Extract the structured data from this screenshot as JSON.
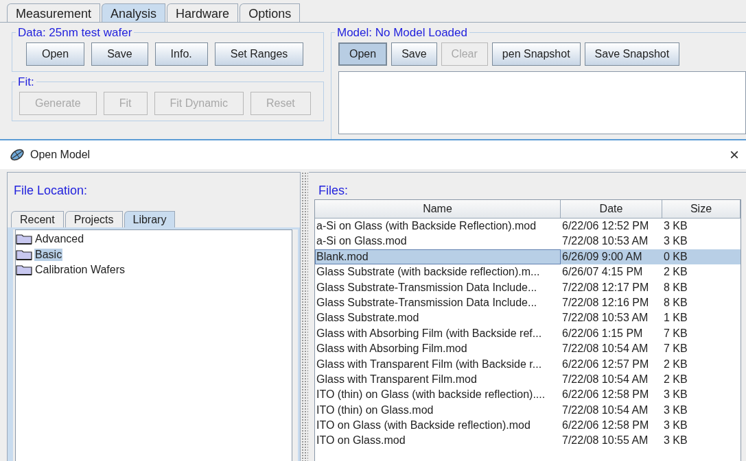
{
  "main_tabs": [
    {
      "label": "Measurement",
      "selected": false
    },
    {
      "label": "Analysis",
      "selected": true
    },
    {
      "label": "Hardware",
      "selected": false
    },
    {
      "label": "Options",
      "selected": false
    }
  ],
  "data_group": {
    "title": "Data: 25nm test wafer",
    "buttons": [
      {
        "label": "Open",
        "disabled": false,
        "pressed": false
      },
      {
        "label": "Save",
        "disabled": false,
        "pressed": false
      },
      {
        "label": "Info.",
        "disabled": false,
        "pressed": false
      },
      {
        "label": "Set Ranges",
        "disabled": false,
        "pressed": false
      }
    ]
  },
  "fit_group": {
    "title": "Fit:",
    "buttons": [
      {
        "label": "Generate",
        "disabled": true,
        "pressed": false
      },
      {
        "label": "Fit",
        "disabled": true,
        "pressed": false
      },
      {
        "label": "Fit Dynamic",
        "disabled": true,
        "pressed": false
      },
      {
        "label": "Reset",
        "disabled": true,
        "pressed": false
      }
    ]
  },
  "model_group": {
    "title": "Model: No Model Loaded",
    "buttons": [
      {
        "label": "Open",
        "disabled": false,
        "pressed": true
      },
      {
        "label": "Save",
        "disabled": false,
        "pressed": false
      },
      {
        "label": "Clear",
        "disabled": true,
        "pressed": false
      },
      {
        "label": "pen Snapshot",
        "disabled": false,
        "pressed": false
      },
      {
        "label": "Save Snapshot",
        "disabled": false,
        "pressed": false
      }
    ]
  },
  "dialog": {
    "title": "Open Model",
    "close": "×",
    "location": {
      "title": "File Location:",
      "tabs": [
        {
          "label": "Recent",
          "selected": false
        },
        {
          "label": "Projects",
          "selected": false
        },
        {
          "label": "Library",
          "selected": true
        }
      ],
      "folders": [
        {
          "name": "Advanced",
          "selected": false
        },
        {
          "name": "Basic",
          "selected": true
        },
        {
          "name": "Calibration Wafers",
          "selected": false
        }
      ]
    },
    "files": {
      "title": "Files:",
      "columns": [
        "Name",
        "Date",
        "Size"
      ],
      "rows": [
        {
          "name": "a-Si on Glass (with Backside Reflection).mod",
          "date": "6/22/06 12:52 PM",
          "size": "3 KB",
          "selected": false
        },
        {
          "name": "a-Si on Glass.mod",
          "date": "7/22/08 10:53 AM",
          "size": "3 KB",
          "selected": false
        },
        {
          "name": "Blank.mod",
          "date": "6/26/09 9:00 AM",
          "size": "0 KB",
          "selected": true
        },
        {
          "name": "Glass Substrate (with backside reflection).m...",
          "date": "6/26/07 4:15 PM",
          "size": "2 KB",
          "selected": false
        },
        {
          "name": "Glass Substrate-Transmission Data Include...",
          "date": "7/22/08 12:17 PM",
          "size": "8 KB",
          "selected": false
        },
        {
          "name": "Glass Substrate-Transmission Data Include...",
          "date": "7/22/08 12:16 PM",
          "size": "8 KB",
          "selected": false
        },
        {
          "name": "Glass Substrate.mod",
          "date": "7/22/08 10:53 AM",
          "size": "1 KB",
          "selected": false
        },
        {
          "name": "Glass with Absorbing Film (with Backside ref...",
          "date": "6/22/06 1:15 PM",
          "size": "7 KB",
          "selected": false
        },
        {
          "name": "Glass with Absorbing Film.mod",
          "date": "7/22/08 10:54 AM",
          "size": "7 KB",
          "selected": false
        },
        {
          "name": "Glass with Transparent Film (with Backside r...",
          "date": "6/22/06 12:57 PM",
          "size": "2 KB",
          "selected": false
        },
        {
          "name": "Glass with Transparent Film.mod",
          "date": "7/22/08 10:54 AM",
          "size": "2 KB",
          "selected": false
        },
        {
          "name": "ITO (thin) on Glass (with backside reflection)....",
          "date": "6/22/06 12:58 PM",
          "size": "3 KB",
          "selected": false
        },
        {
          "name": "ITO (thin) on Glass.mod",
          "date": "7/22/08 10:54 AM",
          "size": "3 KB",
          "selected": false
        },
        {
          "name": "ITO on Glass (with Backside reflection).mod",
          "date": "6/22/06 12:58 PM",
          "size": "3 KB",
          "selected": false
        },
        {
          "name": "ITO on Glass.mod",
          "date": "7/22/08 10:55 AM",
          "size": "3 KB",
          "selected": false
        }
      ]
    }
  }
}
